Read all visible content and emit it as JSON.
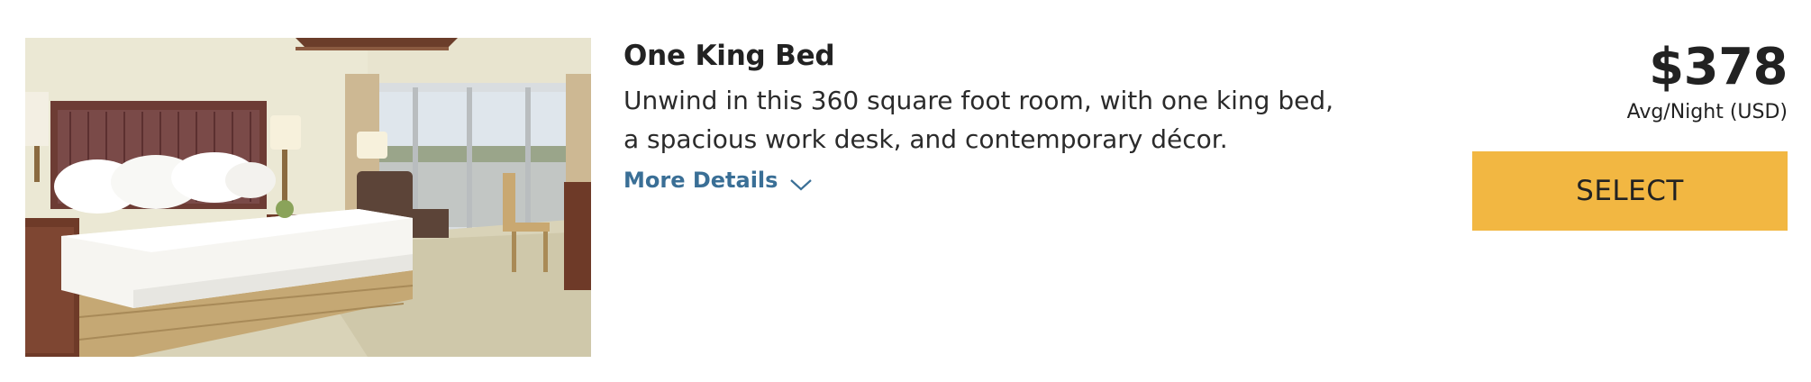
{
  "room": {
    "title": "One King Bed",
    "description": "Unwind in this 360 square foot room, with one king bed, a spacious work desk, and contemporary décor.",
    "more_details_label": "More Details",
    "photo_icon": "hotel-room-photo"
  },
  "pricing": {
    "amount": "$378",
    "note": "Avg/Night (USD)"
  },
  "actions": {
    "select_label": "SELECT"
  },
  "colors": {
    "link": "#3a6f96",
    "select_button": "#f2b742",
    "text": "#222222"
  }
}
